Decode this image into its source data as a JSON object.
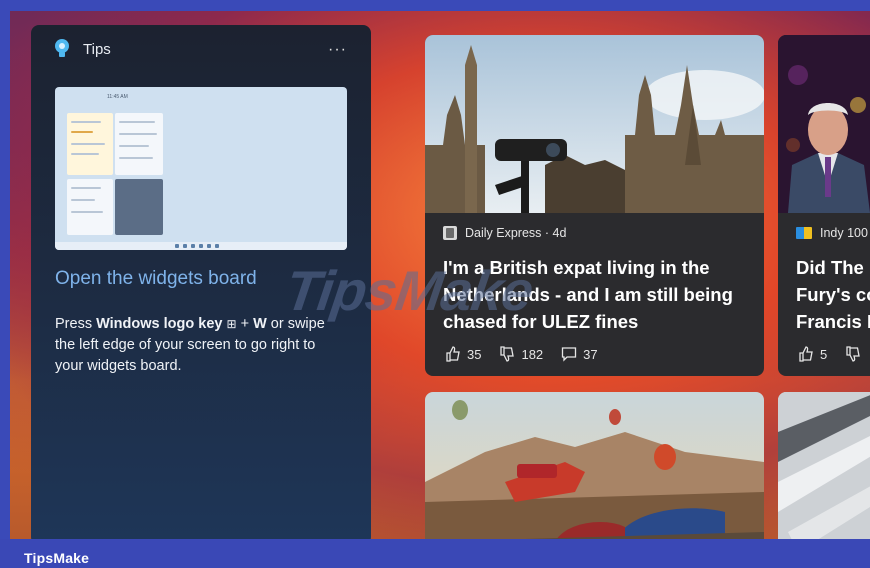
{
  "tips": {
    "title": "Tips",
    "more_label": "···",
    "preview_time": "11:45 AM",
    "link_text": "Open the widgets board",
    "body_prefix": "Press ",
    "body_key": "Windows logo key",
    "body_glyph": "⊞",
    "body_plus": " + ",
    "body_w": "W",
    "body_suffix": " or swipe the left edge of your screen to go right to your widgets board."
  },
  "news": [
    {
      "source": "Daily Express · 4d",
      "title": "I'm a British expat living in the Netherlands - and I am still being chased for ULEZ fines",
      "likes": "35",
      "dislikes": "182",
      "comments": "37"
    },
    {
      "source": "Indy 100",
      "title_lines": [
        "Did The",
        "Fury's co",
        "Francis M"
      ],
      "likes": "5"
    }
  ],
  "watermark": "TipsMake",
  "brand": "TipsMake"
}
